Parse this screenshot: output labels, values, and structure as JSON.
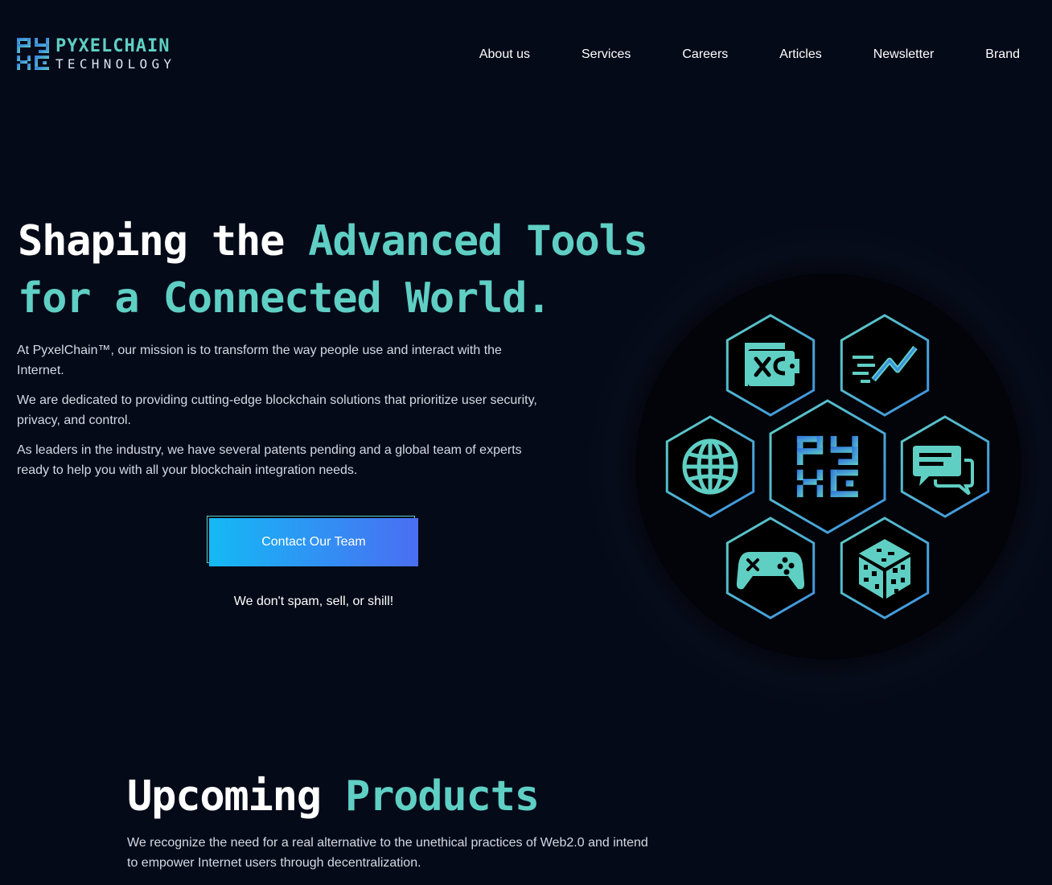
{
  "brand": {
    "name": "PYXELCHAIN",
    "tagline": "TECHNOLOGY"
  },
  "nav": {
    "items": [
      {
        "label": "About us"
      },
      {
        "label": "Services"
      },
      {
        "label": "Careers"
      },
      {
        "label": "Articles"
      },
      {
        "label": "Newsletter"
      },
      {
        "label": "Brand"
      }
    ]
  },
  "hero": {
    "title_line1_white": "Shaping the ",
    "title_line1_accent": "Advanced Tools",
    "title_line2_accent": "for a Connected World.",
    "paragraphs": [
      "At PyxelChain™, our mission is to transform the way people use and interact with the Internet.",
      "We are dedicated to providing cutting-edge blockchain solutions that prioritize user security, privacy, and control.",
      "As leaders in the industry, we have several patents pending and a global team of experts ready to help you with all your blockchain integration needs."
    ],
    "cta_label": "Contact Our Team",
    "cta_note": "We don't spam, sell, or shill!"
  },
  "hex_icons": [
    "wallet-icon",
    "speed-chart-icon",
    "globe-icon",
    "pyxelchain-logo-icon",
    "chat-icon",
    "gamepad-icon",
    "cube-icon"
  ],
  "products": {
    "title_white": "Upcoming ",
    "title_accent": "Products",
    "description": "We recognize the need for a real alternative to the unethical practices of Web2.0 and intend to empower Internet users through decentralization."
  },
  "colors": {
    "background": "#050a18",
    "accent": "#5fcfc4",
    "gradient_start": "#14b9f4",
    "gradient_end": "#4a6ef3"
  }
}
